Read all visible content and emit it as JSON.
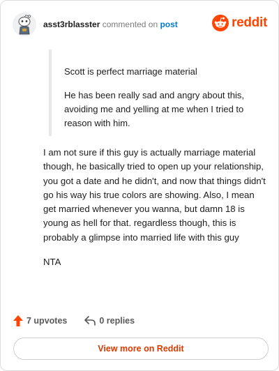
{
  "header": {
    "username": "asst3rblasster",
    "action_text": "commented on",
    "post_link": "post",
    "brand_name": "reddit",
    "brand_color": "#ff4500",
    "avatar_icon": "snoo-avatar-icon"
  },
  "quote": {
    "paragraphs": [
      "Scott is perfect marriage material",
      "He has been really sad and angry about this, avoiding me and yelling at me when I tried to reason with him."
    ]
  },
  "comment": {
    "paragraphs": [
      "I am not sure if this guy is actually marriage material though, he basically tried to open up your relationship, you got a date and he didn't, and now that things didn't go his way his true colors are showing. Also, I mean get married whenever you wanna, but damn 18 is young as hell for that. regardless though, this is probably a glimpse into married life with this guy",
      "NTA"
    ]
  },
  "footer": {
    "upvotes_label": "7 upvotes",
    "upvote_icon": "upvote-arrow-icon",
    "upvote_color": "#ff4500",
    "replies_label": "0 replies",
    "reply_icon": "reply-arrow-icon"
  },
  "actions": {
    "view_more_label": "View more on Reddit",
    "accent_color": "#d93a00"
  }
}
